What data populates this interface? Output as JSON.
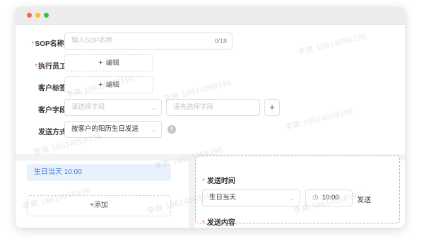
{
  "form": {
    "sop_name": {
      "label": "SOP名称:",
      "placeholder": "输入SOP名称",
      "counter": "0/18"
    },
    "executor": {
      "label": "执行员工",
      "button_label": "编辑"
    },
    "customer_tag": {
      "label": "客户标签",
      "button_label": "编辑"
    },
    "customer_field": {
      "label": "客户字段",
      "field_placeholder": "请选择字段",
      "value_placeholder": "请先选择字段"
    },
    "send_mode": {
      "label": "发送方式",
      "value": "按客户的阳历生日发送"
    }
  },
  "rules": {
    "items": [
      {
        "label": "生日当天 10:00"
      }
    ],
    "add_label": "+添加"
  },
  "detail": {
    "send_time_label": "发送时间",
    "day_value": "生日当天",
    "time_value": "10:00",
    "send_suffix": "发送",
    "send_content_label": "发送内容"
  },
  "watermark_text": "李爽 18614058196",
  "colors": {
    "primary": "#3a7bd5",
    "required": "#f56c6c",
    "highlight_border": "#f2a07e",
    "selected_item_bg": "#e8f1fd"
  }
}
